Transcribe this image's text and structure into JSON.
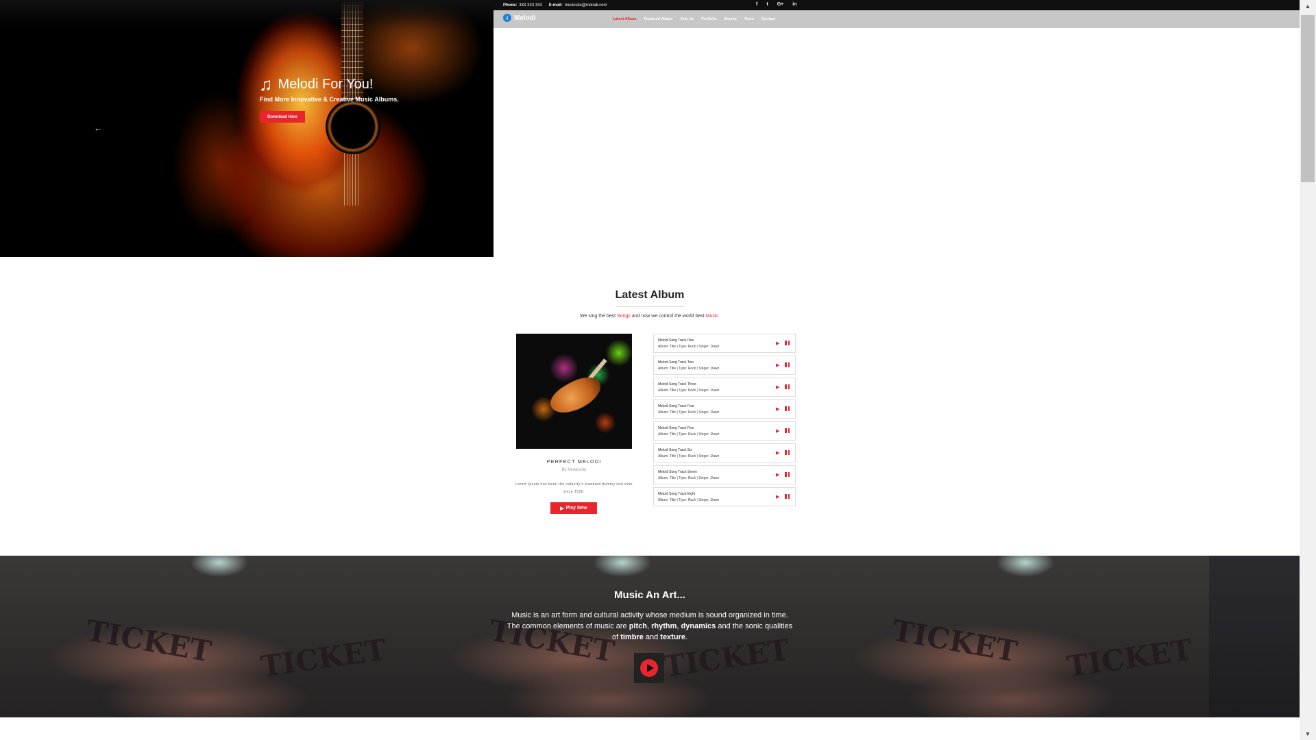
{
  "topbar": {
    "phone_label": "Phone:",
    "phone_value": "333 333 333",
    "email_label": "E-mail:",
    "email_value": "musicsite@melodi.com",
    "social_icons": [
      "facebook-icon",
      "twitter-icon",
      "google-plus-icon",
      "linkedin-icon"
    ],
    "social_glyphs": [
      "f",
      "t",
      "G+",
      "in"
    ]
  },
  "nav": {
    "logo_badge": "i",
    "logo": "Melodi",
    "items": [
      "Latest Album",
      "Featured Album",
      "Join Us",
      "Portfolio",
      "Events",
      "Team",
      "Contact"
    ],
    "active_index": 0
  },
  "hero": {
    "title": "Melodi For You!",
    "subtitle": "Find More Innovative & Creative Music Albums.",
    "button": "Download Here",
    "prev_arrow": "←"
  },
  "latest": {
    "title": "Latest Album",
    "subtitle_pre": "We sing the best ",
    "subtitle_red1": "Songs",
    "subtitle_mid": " and now we control the world best ",
    "subtitle_red2": "Music",
    "subtitle_end": ".",
    "album": {
      "name": "PERFECT MELODI",
      "by": "By Himanshu",
      "desc": "Lorem Ipsum has been the industry's standard dummy text ever since 1500.",
      "play": "Play Now"
    },
    "tracks": [
      {
        "name": "Melodi Song Track One",
        "meta_pre": "Album: Title  |  Type: ",
        "type": "Rock",
        "meta_mid": "  |  Singer: ",
        "singer": "Dawn"
      },
      {
        "name": "Melodi Song Track Two",
        "meta_pre": "Album: Title  |  Type: ",
        "type": "Rock",
        "meta_mid": "  |  Singer: ",
        "singer": "Dawn"
      },
      {
        "name": "Melodi Song Track Three",
        "meta_pre": "Album: Title  |  Type: ",
        "type": "Rock",
        "meta_mid": "  |  Singer: ",
        "singer": "Dawn"
      },
      {
        "name": "Melodi Song Track Four",
        "meta_pre": "Album: Title  |  Type: ",
        "type": "Rock",
        "meta_mid": "  |  Singer: ",
        "singer": "Dawn"
      },
      {
        "name": "Melodi Song Track Five",
        "meta_pre": "Album: Title  |  Type: ",
        "type": "Rock",
        "meta_mid": "  |  Singer: ",
        "singer": "Dawn"
      },
      {
        "name": "Melodi Song Track Six",
        "meta_pre": "Album: Title  |  Type: ",
        "type": "Rock",
        "meta_mid": "  |  Singer: ",
        "singer": "Dawn"
      },
      {
        "name": "Melodi Song Track Seven",
        "meta_pre": "Album: Title  |  Type: ",
        "type": "Rock",
        "meta_mid": "  |  Singer: ",
        "singer": "Dawn"
      },
      {
        "name": "Melodi Song Track Eight",
        "meta_pre": "Album: Title  |  Type: ",
        "type": "Rock",
        "meta_mid": "  |  Singer: ",
        "singer": "Dawn"
      }
    ]
  },
  "art": {
    "title": "Music An Art...",
    "line1": "Music is an art form and cultural activity whose medium is sound organized in time.",
    "line2_pre": "The common elements of music are ",
    "pitch": "pitch",
    "comma1": ", ",
    "rhythm": "rhythm",
    "comma2": ", ",
    "dynamics": "dynamics",
    "line2_post": " and the sonic qualities",
    "line3_pre": "of ",
    "timbre": "timbre",
    "and": " and ",
    "texture": "texture",
    "line3_end": ".",
    "ticket_word": "TICKET"
  },
  "colors": {
    "accent": "#e8252c",
    "nav_bg": "#c7c7c7",
    "topbar_bg": "#0f0f0f",
    "logo_badge": "#1f7fd6"
  }
}
